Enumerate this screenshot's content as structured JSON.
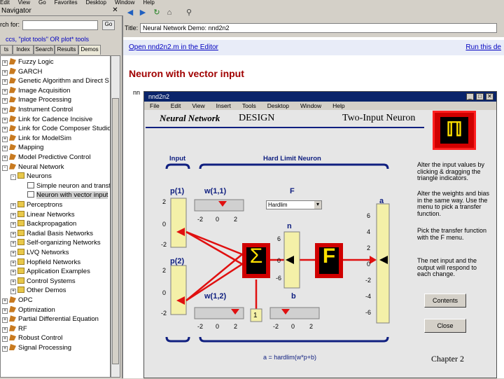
{
  "menubar": [
    "Edit",
    "View",
    "Go",
    "Favorites",
    "Desktop",
    "Window",
    "Help"
  ],
  "navigator": {
    "title": "Navigator",
    "search_label": "rch for:",
    "search_value": "",
    "search_go": "Go",
    "hint": "ccs, \"plot tools\" OR plot* tools",
    "tabs": [
      "ts",
      "Index",
      "Search",
      "Results",
      "Demos"
    ],
    "active_tab": "Demos",
    "tree": [
      {
        "indent": 0,
        "expander": "+",
        "icon": "book",
        "label": "Fuzzy Logic"
      },
      {
        "indent": 0,
        "expander": "+",
        "icon": "book",
        "label": "GARCH"
      },
      {
        "indent": 0,
        "expander": "+",
        "icon": "book",
        "label": "Genetic Algorithm and Direct S"
      },
      {
        "indent": 0,
        "expander": "+",
        "icon": "book",
        "label": "Image Acquisition"
      },
      {
        "indent": 0,
        "expander": "+",
        "icon": "book",
        "label": "Image Processing"
      },
      {
        "indent": 0,
        "expander": "+",
        "icon": "book",
        "label": "Instrument Control"
      },
      {
        "indent": 0,
        "expander": "+",
        "icon": "book",
        "label": "Link for Cadence Incisive"
      },
      {
        "indent": 0,
        "expander": "+",
        "icon": "book",
        "label": "Link for Code Composer Studio"
      },
      {
        "indent": 0,
        "expander": "+",
        "icon": "book",
        "label": "Link for ModelSim"
      },
      {
        "indent": 0,
        "expander": "+",
        "icon": "book",
        "label": "Mapping"
      },
      {
        "indent": 0,
        "expander": "+",
        "icon": "book",
        "label": "Model Predictive Control"
      },
      {
        "indent": 0,
        "expander": "-",
        "icon": "book",
        "label": "Neural Network"
      },
      {
        "indent": 1,
        "expander": "-",
        "icon": "folder",
        "label": "Neurons"
      },
      {
        "indent": 2,
        "expander": "",
        "icon": "doc",
        "label": "Simple neuron and transfer"
      },
      {
        "indent": 2,
        "expander": "",
        "icon": "doc",
        "label": "Neuron with vector input",
        "selected": true
      },
      {
        "indent": 1,
        "expander": "+",
        "icon": "folder",
        "label": "Perceptrons"
      },
      {
        "indent": 1,
        "expander": "+",
        "icon": "folder",
        "label": "Linear Networks"
      },
      {
        "indent": 1,
        "expander": "+",
        "icon": "folder",
        "label": "Backpropagation"
      },
      {
        "indent": 1,
        "expander": "+",
        "icon": "folder",
        "label": "Radial Basis Networks"
      },
      {
        "indent": 1,
        "expander": "+",
        "icon": "folder",
        "label": "Self-organizing Networks"
      },
      {
        "indent": 1,
        "expander": "+",
        "icon": "folder",
        "label": "LVQ Networks"
      },
      {
        "indent": 1,
        "expander": "+",
        "icon": "folder",
        "label": "Hopfield Networks"
      },
      {
        "indent": 1,
        "expander": "+",
        "icon": "folder",
        "label": "Application Examples"
      },
      {
        "indent": 1,
        "expander": "+",
        "icon": "folder",
        "label": "Control Systems"
      },
      {
        "indent": 1,
        "expander": "+",
        "icon": "folder",
        "label": "Other Demos"
      },
      {
        "indent": 0,
        "expander": "+",
        "icon": "book",
        "label": "OPC"
      },
      {
        "indent": 0,
        "expander": "+",
        "icon": "book",
        "label": "Optimization"
      },
      {
        "indent": 0,
        "expander": "+",
        "icon": "book",
        "label": "Partial Differential Equation"
      },
      {
        "indent": 0,
        "expander": "+",
        "icon": "book",
        "label": "RF"
      },
      {
        "indent": 0,
        "expander": "+",
        "icon": "book",
        "label": "Robust Control"
      },
      {
        "indent": 0,
        "expander": "+",
        "icon": "book",
        "label": "Signal Processing"
      }
    ]
  },
  "viewer": {
    "title_label": "Title:",
    "title_value": "Neural Network Demo: nnd2n2",
    "open_link": "Open nnd2n2.m in the Editor",
    "run_link": "Run this de",
    "page_title": "Neuron with vector input",
    "nnd_text": "nn"
  },
  "figure": {
    "window_title": "nnd2n2",
    "menu": [
      "File",
      "Edit",
      "View",
      "Insert",
      "Tools",
      "Desktop",
      "Window",
      "Help"
    ],
    "banner_left": "Neural Network",
    "banner_left2": "DESIGN",
    "banner_right": "Two-Input Neuron",
    "logo": "ℿ",
    "input_label": "Input",
    "neuron_label": "Hard Limit Neuron",
    "p1_label": "p(1)",
    "p2_label": "p(2)",
    "w11_label": "w(1,1)",
    "w12_label": "w(1,2)",
    "f_label": "F",
    "n_label": "n",
    "b_label": "b",
    "a_label": "a",
    "transfer_select": "Hardlim",
    "slider_ticks": [
      "-2",
      "0",
      "2"
    ],
    "p1_ticks": [
      "2",
      "0",
      "-2"
    ],
    "p2_ticks": [
      "2",
      "0",
      "-2"
    ],
    "n_ticks": [
      "6",
      "0",
      "-6"
    ],
    "a_ticks": [
      "6",
      "4",
      "2",
      "0",
      "-2",
      "-4",
      "-6"
    ],
    "bias_input": "1",
    "sigma": "Σ",
    "f_box": "F",
    "equation": "a = hardlim(w*p+b)",
    "instructions": [
      "Alter the input values by clicking & dragging the triangle indicators.",
      "Alter the weights and bias in the same way. Use the menu to pick a transfer function.",
      "Pick the transfer function with the F menu.",
      "The net input and the output will respond to each change."
    ],
    "contents_button": "Contents",
    "close_button": "Close",
    "chapter": "Chapter 2",
    "colors": {
      "sum_box": "#d00000",
      "slider_fill": "#f4f0a8",
      "marker": "#e01010",
      "wire": "#102080"
    }
  }
}
